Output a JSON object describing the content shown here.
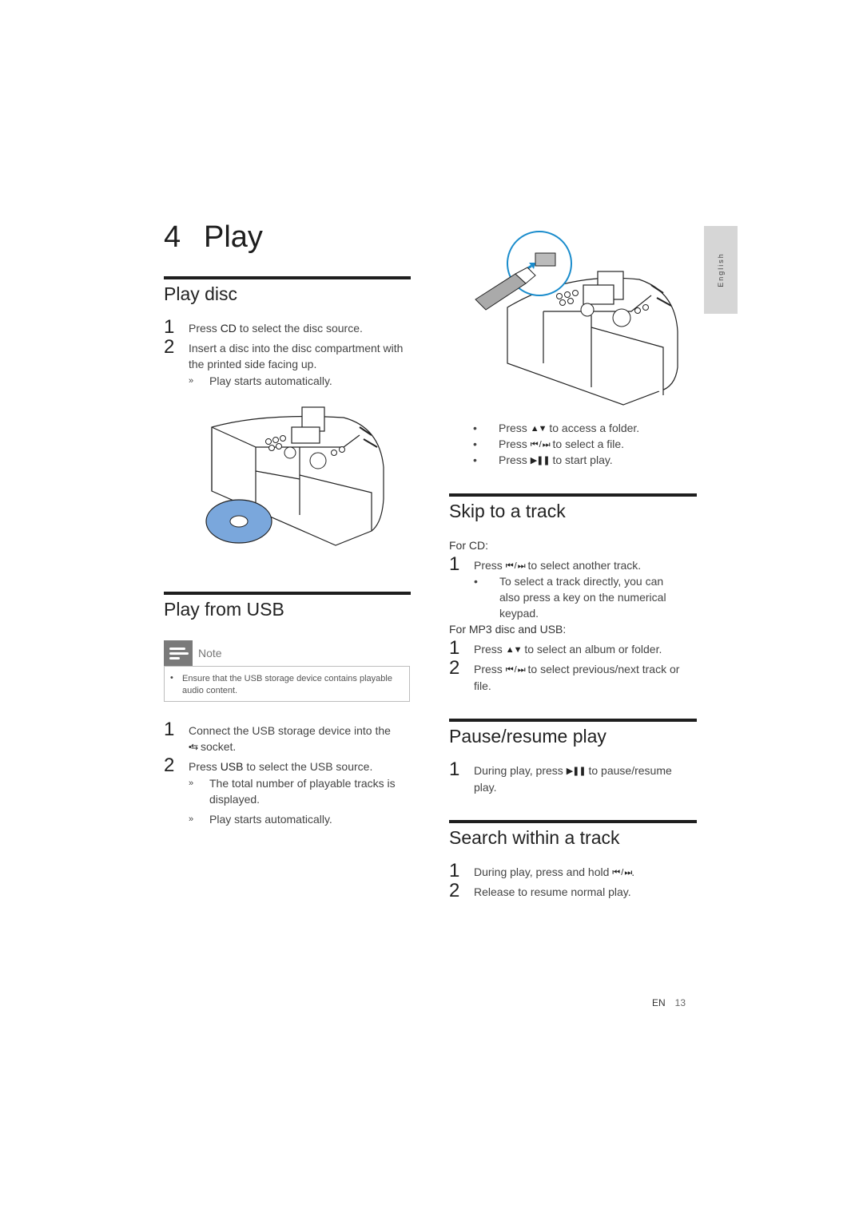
{
  "chapter": {
    "number": "4",
    "title": "Play"
  },
  "side_tab": {
    "label": "English"
  },
  "play_disc": {
    "heading": "Play disc",
    "steps": [
      {
        "num": "1",
        "pre": "Press ",
        "key": "CD",
        "post": " to select the disc source."
      },
      {
        "num": "2",
        "text": "Insert a disc into the disc compartment with the printed side facing up."
      }
    ],
    "result": {
      "mark": "»",
      "text": "Play starts automatically."
    },
    "illustration": "Micro system with CD disc"
  },
  "play_usb": {
    "heading": "Play from USB",
    "note": {
      "label": "Note",
      "bullet": "•",
      "text": "Ensure that the USB storage device contains playable audio content."
    },
    "steps": [
      {
        "num": "1",
        "line1": "Connect the USB storage device into the",
        "line2": "socket."
      },
      {
        "num": "2",
        "pre": "Press ",
        "key": "USB",
        "post": " to select the USB source."
      }
    ],
    "results": [
      {
        "mark": "»",
        "text": "The total number of playable tracks is displayed."
      },
      {
        "mark": "»",
        "text": "Play starts automatically."
      }
    ]
  },
  "usb_illustration": {
    "label": "USB stick inserted into socket",
    "highlight_color": "#1a8ccc"
  },
  "usb_bullets": [
    {
      "mark": "•",
      "pre": "Press ",
      "icon": "▲▼",
      "post": " to access a folder."
    },
    {
      "mark": "•",
      "pre": "Press ",
      "icon": "⏮ / ⏭",
      "post": " to select a file."
    },
    {
      "mark": "•",
      "pre": "Press ",
      "icon": "▶❚❚",
      "post": " to start play."
    }
  ],
  "skip_track": {
    "heading": "Skip to a track",
    "for_cd_label": "For CD:",
    "cd_step": {
      "num": "1",
      "pre": "Press ",
      "icon": "⏮ / ⏭",
      "post": " to select another track."
    },
    "cd_bullet": {
      "mark": "•",
      "text": "To select a track directly, you can also press a key on the numerical keypad."
    },
    "for_mp3_label": "For MP3 disc and USB:",
    "mp3_steps": [
      {
        "num": "1",
        "pre": "Press ",
        "icon": "▲▼",
        "post": " to select an album or folder."
      },
      {
        "num": "2",
        "pre": "Press ",
        "icon": "⏮ / ⏭",
        "post": " to select previous/next track or file."
      }
    ]
  },
  "pause_resume": {
    "heading": "Pause/resume play",
    "step": {
      "num": "1",
      "pre": "During play, press ",
      "icon": "▶❚❚",
      "post": " to pause/resume play."
    }
  },
  "search_track": {
    "heading": "Search within a track",
    "steps": [
      {
        "num": "1",
        "pre": "During play, press and hold ",
        "icon": "⏮ / ⏭",
        "post": "."
      },
      {
        "num": "2",
        "text": "Release to resume normal play."
      }
    ]
  },
  "footer": {
    "lang": "EN",
    "page": "13"
  },
  "colors": {
    "disc_blue": "#7aa7dc",
    "tab_gray": "#d6d6d6",
    "note_gray": "#7a7a7a"
  }
}
